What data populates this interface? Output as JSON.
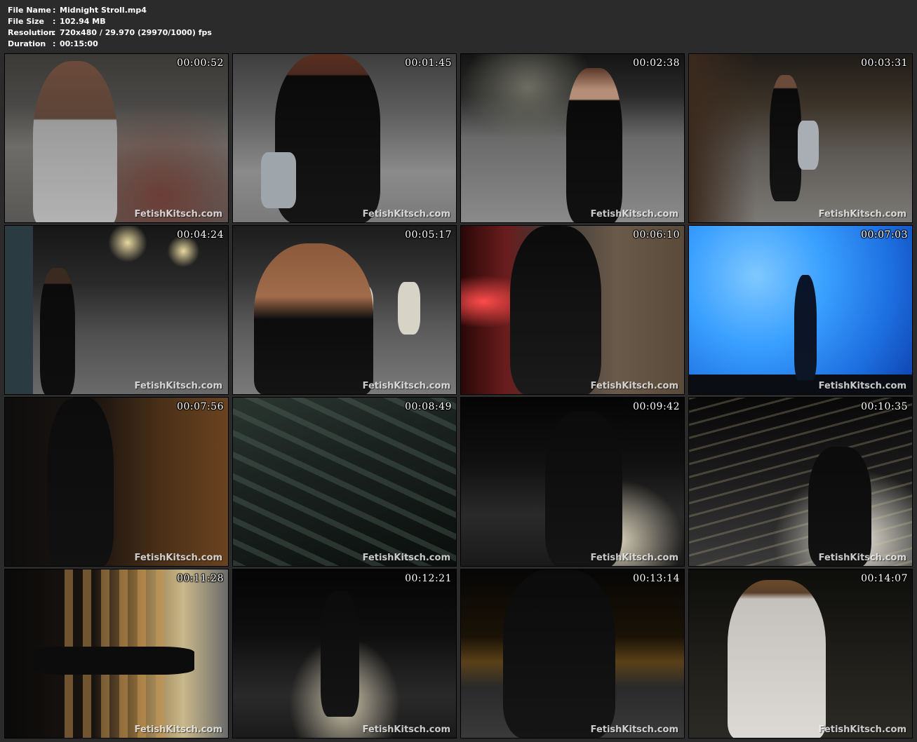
{
  "info": {
    "rows": [
      {
        "label": "File Name",
        "value": "Midnight Stroll.mp4"
      },
      {
        "label": "File Size",
        "value": "102.94 MB"
      },
      {
        "label": "Resolution",
        "value": "720x480 / 29.970 (29970/1000) fps"
      },
      {
        "label": "Duration",
        "value": "00:15:00"
      }
    ],
    "separator": ":"
  },
  "watermark": "FetishKitsch.com",
  "thumbnails": [
    {
      "time": "00:00:52"
    },
    {
      "time": "00:01:45"
    },
    {
      "time": "00:02:38"
    },
    {
      "time": "00:03:31"
    },
    {
      "time": "00:04:24"
    },
    {
      "time": "00:05:17"
    },
    {
      "time": "00:06:10"
    },
    {
      "time": "00:07:03"
    },
    {
      "time": "00:07:56"
    },
    {
      "time": "00:08:49"
    },
    {
      "time": "00:09:42"
    },
    {
      "time": "00:10:35"
    },
    {
      "time": "00:11:28"
    },
    {
      "time": "00:12:21"
    },
    {
      "time": "00:13:14"
    },
    {
      "time": "00:14:07"
    }
  ]
}
